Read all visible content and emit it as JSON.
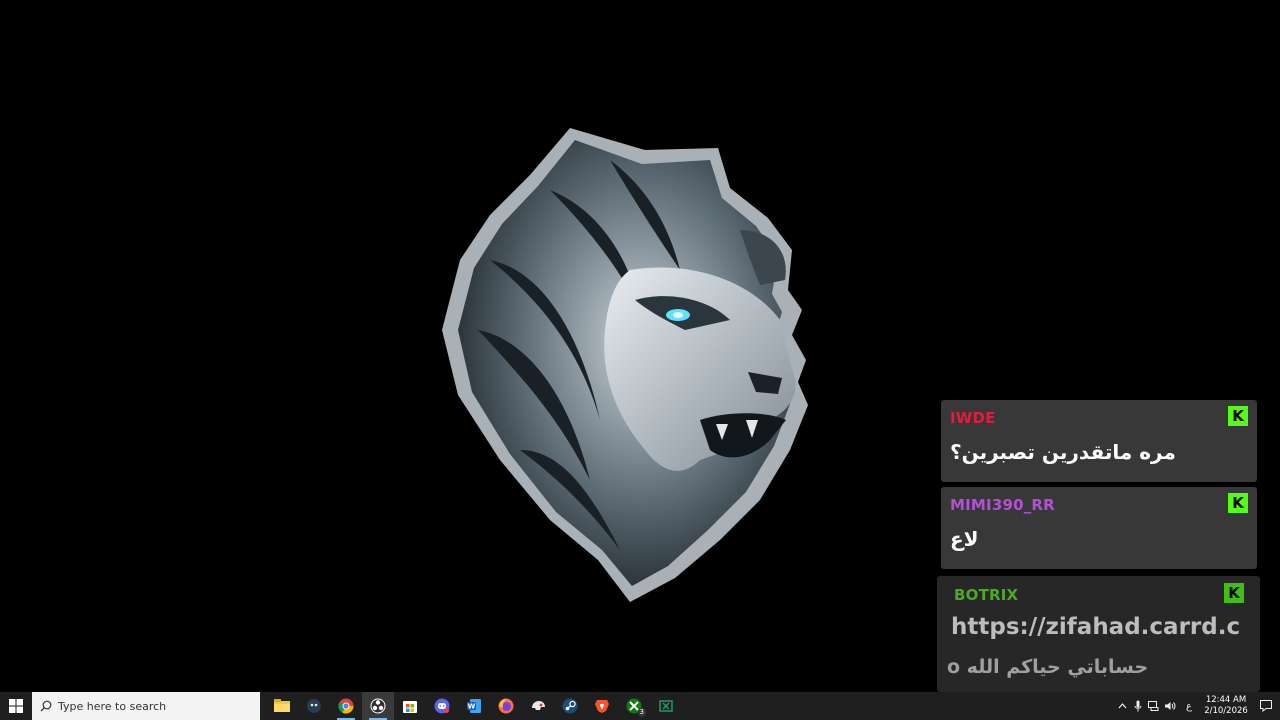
{
  "chat": {
    "messages": [
      {
        "username": "IWDE",
        "text": "مره ماتقدرين تصبرين؟",
        "color": "#e8193c",
        "badge": "kick-icon"
      },
      {
        "username": "MIMI390_RR",
        "text": "لاع",
        "color": "#b54fd8",
        "badge": "kick-icon"
      },
      {
        "username": "BOTRIX",
        "text_line1": "https://zifahad.carrd.c",
        "text_line2": "o حساباتي حياكم الله",
        "color": "#4ea825",
        "badge": "kick-icon"
      }
    ]
  },
  "taskbar": {
    "search_placeholder": "Type here to search",
    "apps": [
      "file-explorer-icon",
      "app-icon",
      "chrome-icon",
      "obs-icon",
      "microsoft-store-icon",
      "discord-icon",
      "word-icon",
      "firefox-icon",
      "app-icon",
      "steam-icon",
      "brave-icon",
      "xbox-icon",
      "excel-icon"
    ],
    "xbox_badge": "3",
    "tray": {
      "language": "ع",
      "time": "12:44 AM",
      "date": "2/10/2026"
    }
  }
}
